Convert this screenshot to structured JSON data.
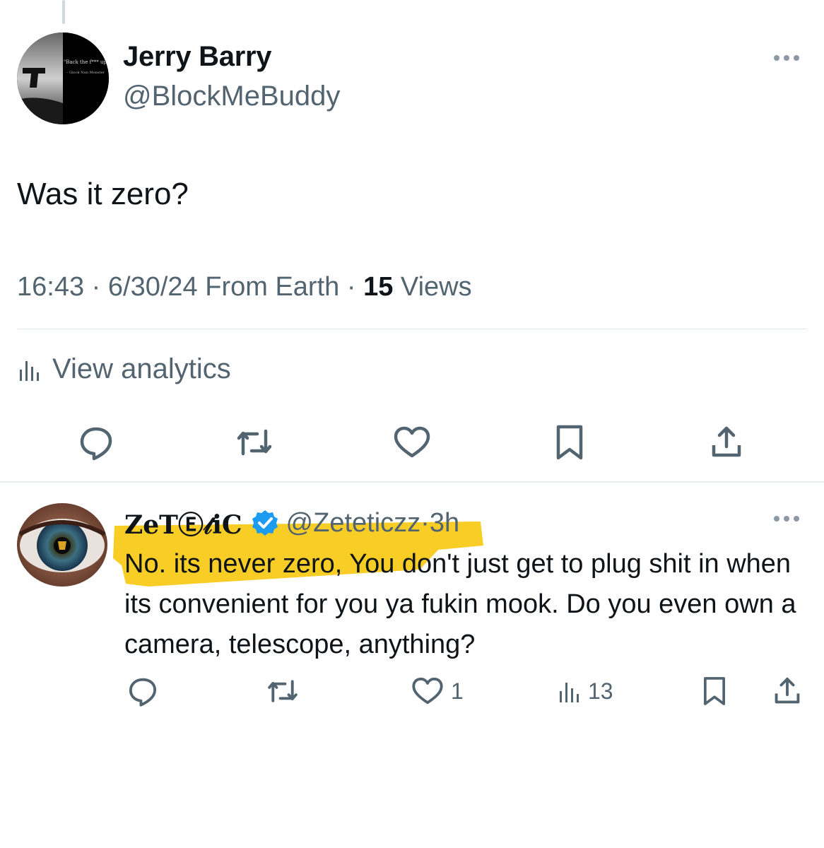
{
  "main_tweet": {
    "author_name": "Jerry Barry",
    "author_handle": "@BlockMeBuddy",
    "avatar_text": "\"Back the f*** up\"",
    "avatar_subtext": "– Glock Nun Monster",
    "text": "Was it zero?",
    "time": "16:43",
    "date": "6/30/24",
    "location": "From Earth",
    "views_count": "15",
    "views_label": "Views",
    "analytics_label": "View analytics",
    "actions": [
      "reply-icon",
      "retweet-icon",
      "like-icon",
      "bookmark-icon",
      "share-icon"
    ]
  },
  "reply": {
    "author_name": "ZeTⒺ𝓉iC",
    "verified": true,
    "author_handle": "@Zeteticzz",
    "age": "3h",
    "text": "No. its never zero, You don't just get to plug shit in when its convenient for you ya fukin mook. Do you even own a camera, telescope, anything?",
    "likes": "1",
    "views": "13",
    "highlight_color": "#f6c400"
  },
  "colors": {
    "text": "#0f1419",
    "secondary": "#536471",
    "verified": "#1d9bf0",
    "divider": "#e1e7ea"
  }
}
